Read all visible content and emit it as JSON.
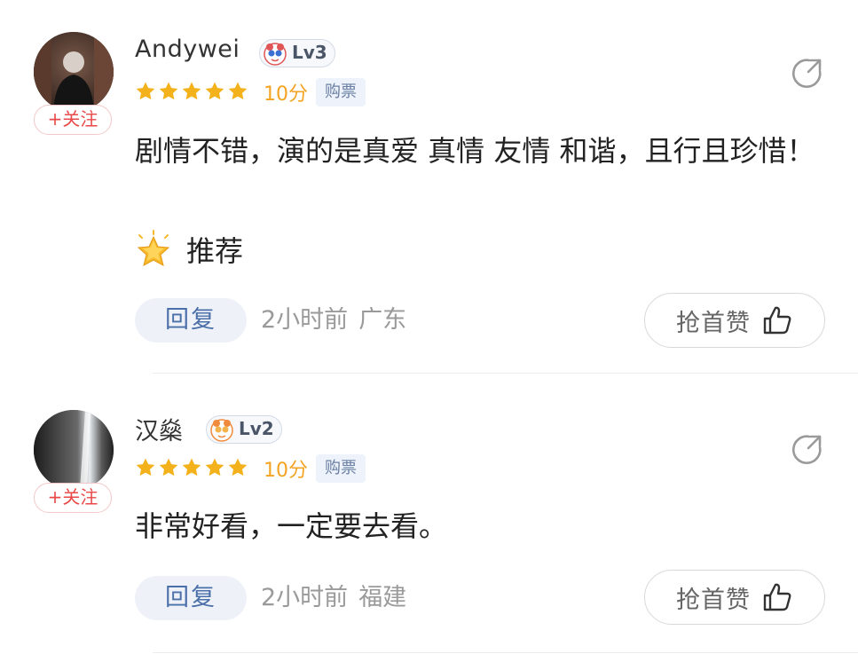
{
  "comments": [
    {
      "username": "Andywei",
      "level": "Lv3",
      "follow_label": "+关注",
      "stars": 5,
      "score": "10分",
      "tag": "购票",
      "text": "剧情不错，演的是真爱 真情 友情 和谐，且行且珍惜！",
      "recommend_text": "推荐",
      "reply_label": "回复",
      "time": "2小时前",
      "location": "广东",
      "like_label": "抢首赞"
    },
    {
      "username": "汉燊",
      "level": "Lv2",
      "follow_label": "+关注",
      "stars": 5,
      "score": "10分",
      "tag": "购票",
      "text": "非常好看，一定要去看。",
      "reply_label": "回复",
      "time": "2小时前",
      "location": "福建",
      "like_label": "抢首赞"
    }
  ],
  "icons": {
    "share": "share-icon",
    "like": "thumbs-up-icon",
    "star": "star-icon",
    "recommend": "sparkle-star-icon",
    "level_badge": "mascot-badge-icon"
  },
  "colors": {
    "star": "#f3b21b",
    "score": "#f3a424",
    "follow": "#e84a4a",
    "reply_bg": "#eef2f8",
    "reply_text": "#4b6fa8",
    "meta": "#9a9a9a"
  }
}
